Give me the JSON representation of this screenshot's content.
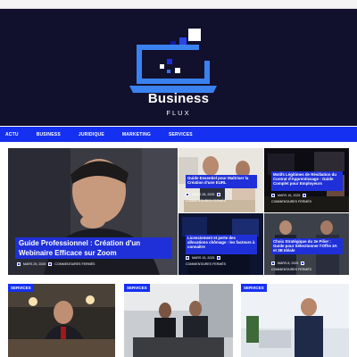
{
  "brand": {
    "name": "Business",
    "sub": "FLUX"
  },
  "nav": [
    "ACTU",
    "BUSINESS",
    "JURIDIQUE",
    "MARKETING",
    "SERVICES"
  ],
  "hero": {
    "title": "Guide Professionnel : Création d'un Webinaire Efficace sur Zoom",
    "date": "MARS 29, 2025",
    "comments": "COMMENTAIRES FERMÉS"
  },
  "cards": [
    {
      "title": "Guide Essentiel pour Maîtriser la Création d'une EURL",
      "date": "MARS 28, 2025",
      "comments": "COMMENTAIRES FERMÉS"
    },
    {
      "title": "Motifs Légitimes de Résiliation du Contrat d'Apprentissage : Guide Complet pour Employeurs",
      "date": "MARS 16, 2025",
      "comments": "COMMENTAIRES FERMÉS"
    },
    {
      "title": "Licenciement et perte des allocations chômage : les facteurs à connaître",
      "date": "MARS 15, 2025",
      "comments": "COMMENTAIRES FERMÉS"
    },
    {
      "title": "Choix Stratégique du 3e Pilier : Guide pour Sélectionner l'Offre 3A et 3B Idéale",
      "date": "MARS 8, 2025",
      "comments": "COMMENTAIRES FERMÉS"
    }
  ],
  "bottom_tags": [
    "SERVICES",
    "SERVICES",
    "SERVICES"
  ]
}
